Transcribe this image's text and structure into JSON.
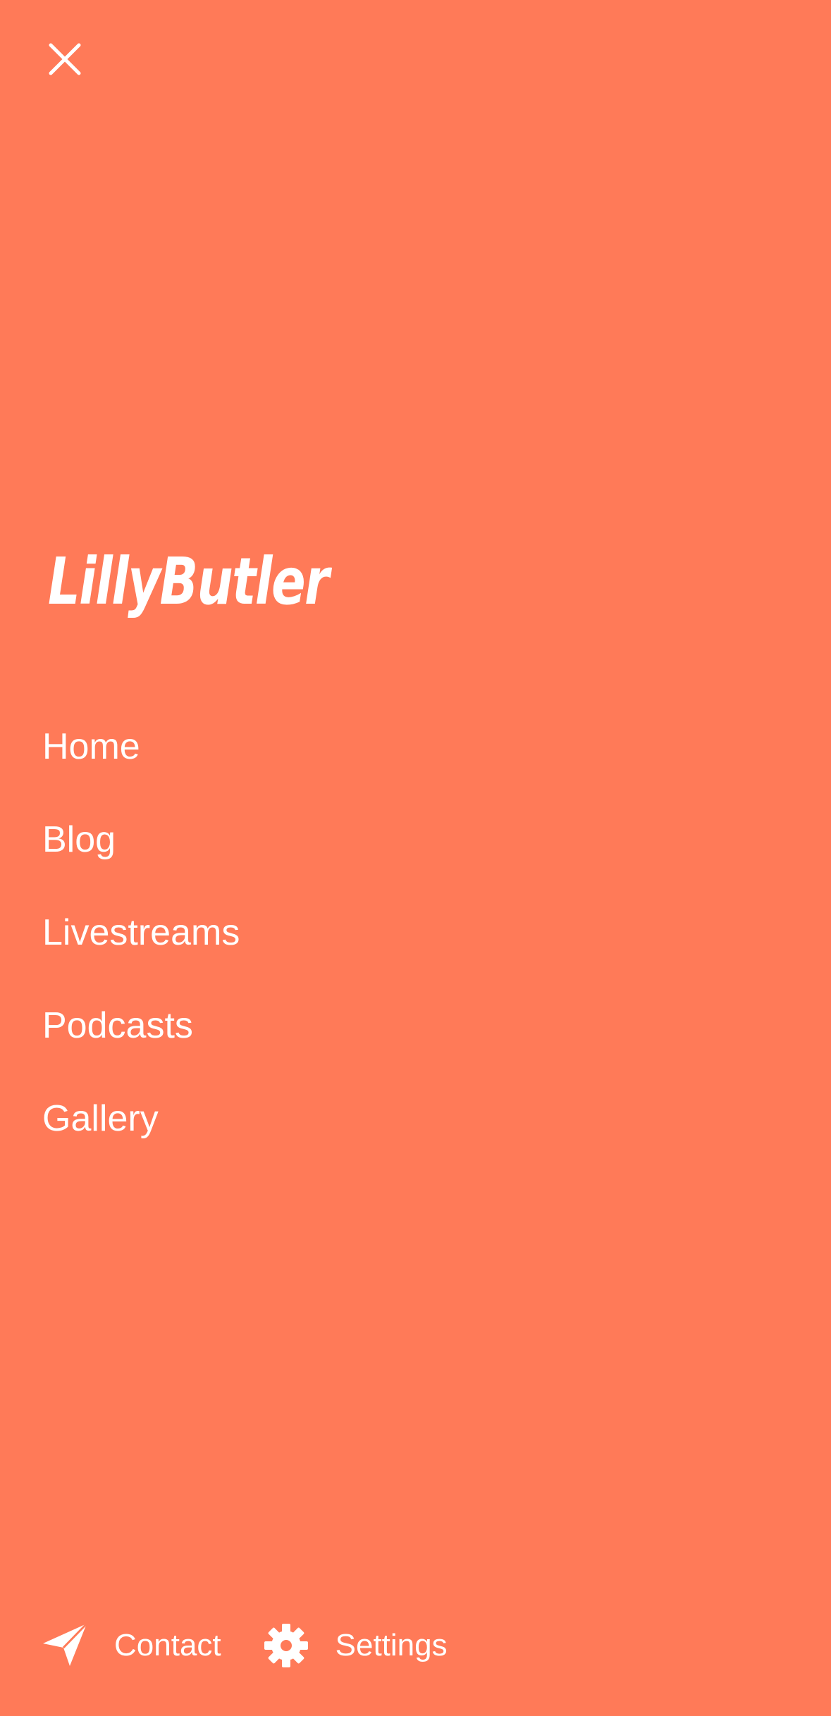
{
  "theme": {
    "background": "#FF7A58",
    "foreground": "#FFFFFF"
  },
  "header": {
    "close_icon": "close-icon"
  },
  "brand": {
    "name": "LillyButler"
  },
  "nav": {
    "items": [
      {
        "label": "Home"
      },
      {
        "label": "Blog"
      },
      {
        "label": "Livestreams"
      },
      {
        "label": "Podcasts"
      },
      {
        "label": "Gallery"
      }
    ]
  },
  "footer": {
    "contact": {
      "label": "Contact",
      "icon": "paper-plane-icon"
    },
    "settings": {
      "label": "Settings",
      "icon": "gear-icon"
    }
  }
}
